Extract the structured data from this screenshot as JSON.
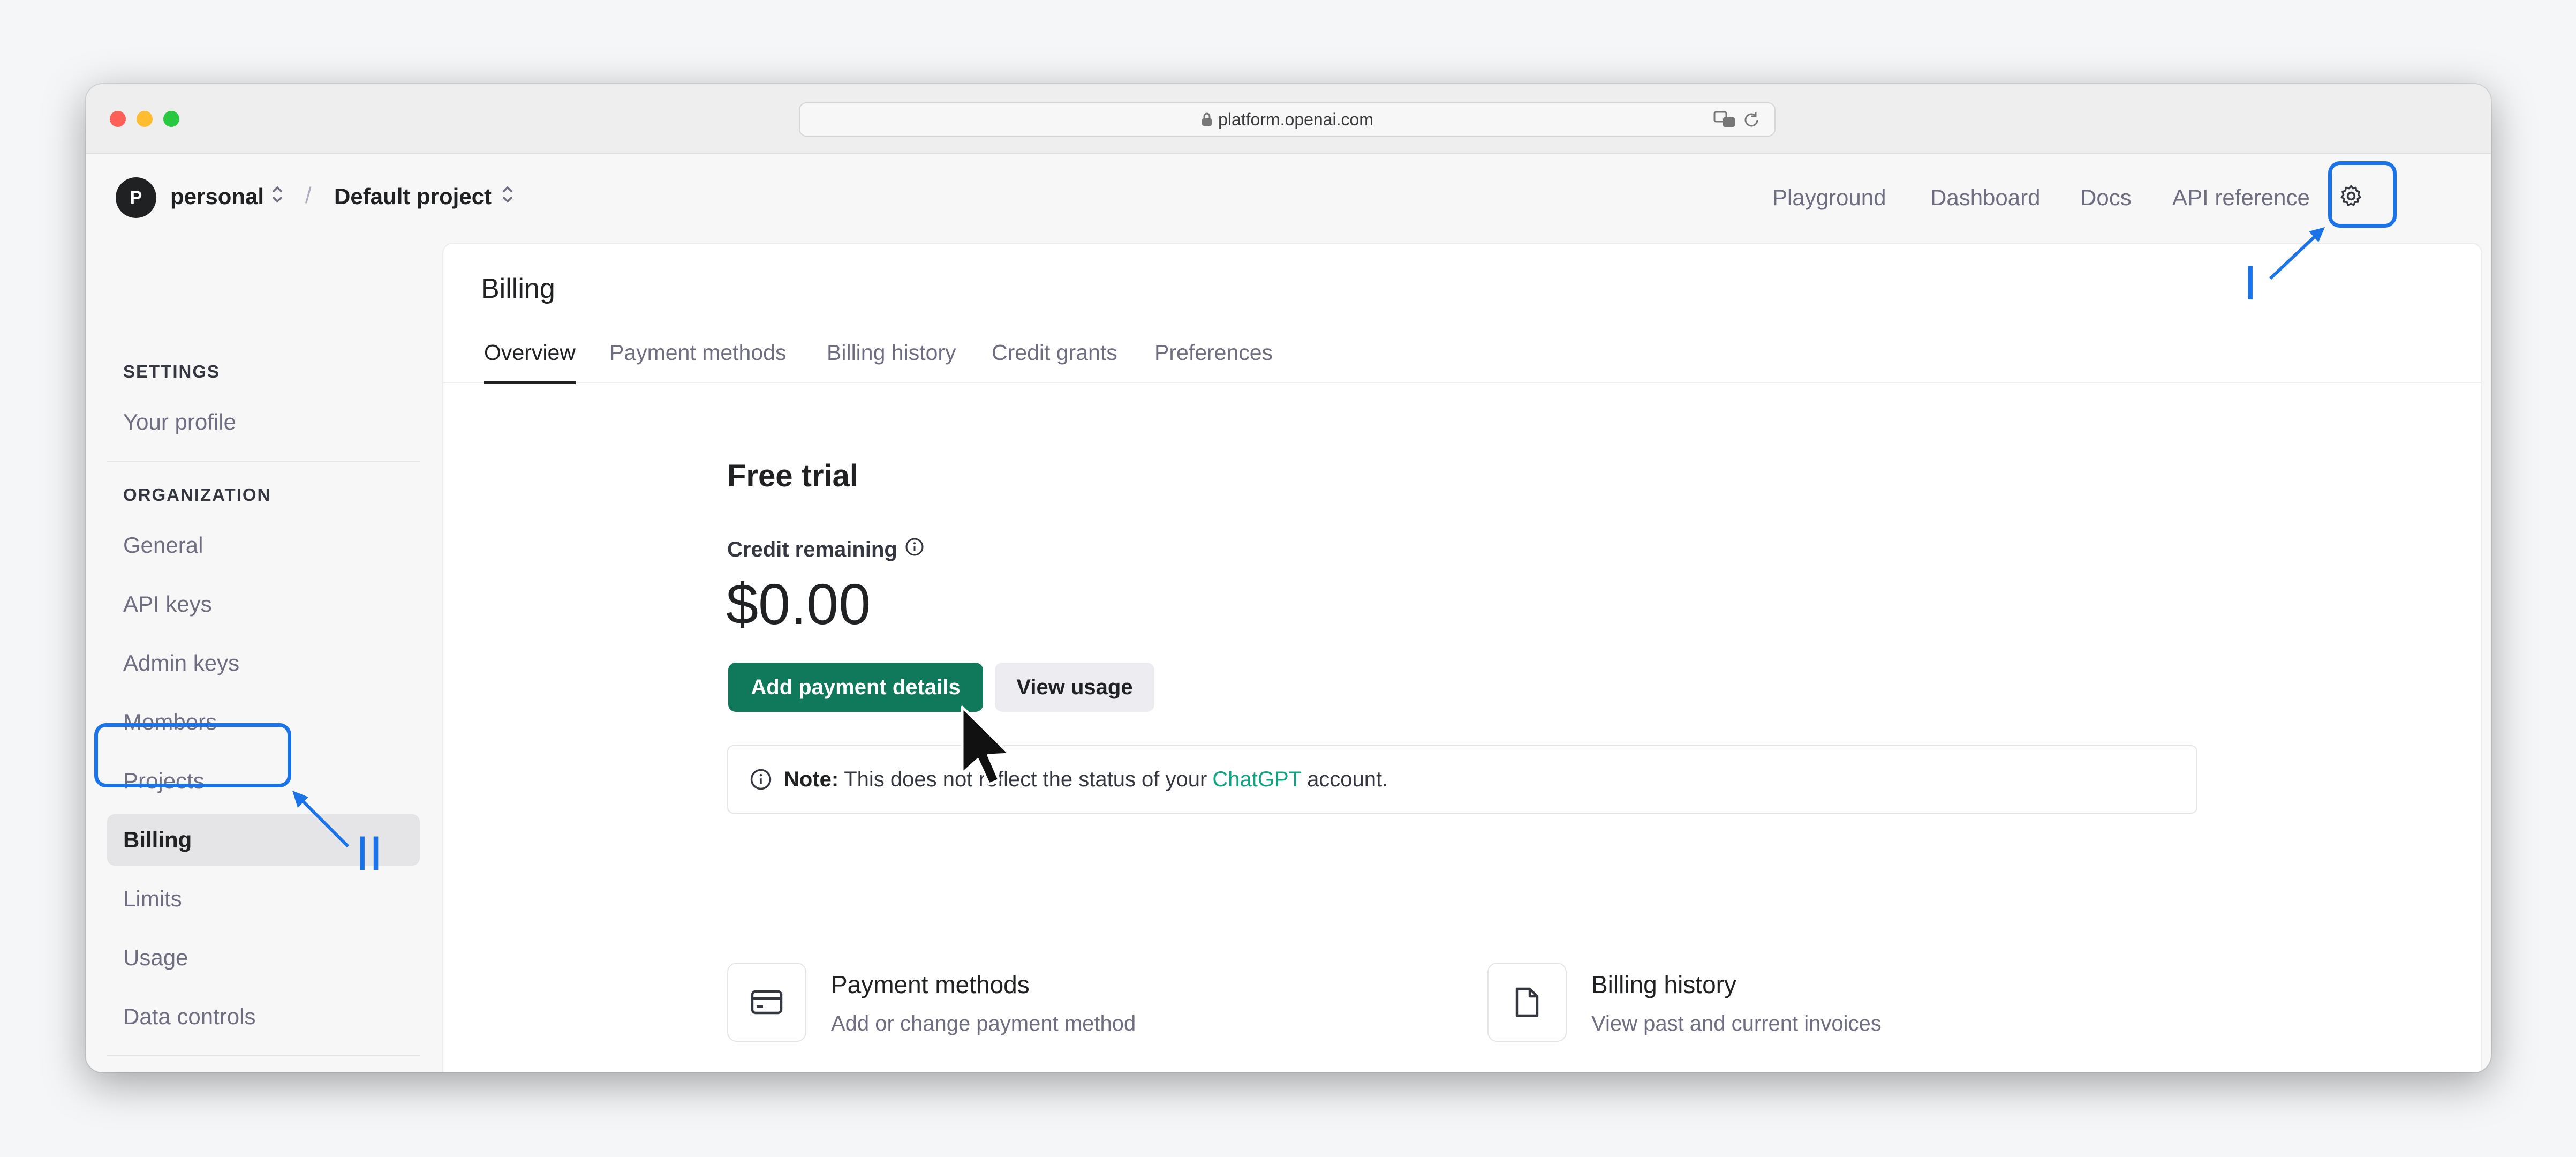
{
  "browser": {
    "url": "platform.openai.com",
    "icons": [
      "lock-icon",
      "translate-icon",
      "reload-icon"
    ]
  },
  "topbar": {
    "avatar_initial": "P",
    "org": "personal",
    "separator": "/",
    "project": "Default project",
    "nav": [
      "Playground",
      "Dashboard",
      "Docs",
      "API reference"
    ],
    "settings_icon": "gear-icon"
  },
  "sidebar": {
    "settings_heading": "SETTINGS",
    "settings_items": [
      "Your profile"
    ],
    "org_heading": "ORGANIZATION",
    "org_items": [
      "General",
      "API keys",
      "Admin keys",
      "Members",
      "Projects",
      "Billing",
      "Limits",
      "Usage",
      "Data controls"
    ],
    "active": "Billing"
  },
  "main": {
    "title": "Billing",
    "tabs": [
      "Overview",
      "Payment methods",
      "Billing history",
      "Credit grants",
      "Preferences"
    ],
    "active_tab": "Overview",
    "plan_title": "Free trial",
    "credit_label": "Credit remaining",
    "credit_amount": "$0.00",
    "add_payment_label": "Add payment details",
    "view_usage_label": "View usage",
    "note": {
      "bold": "Note:",
      "text_before": "This does not reflect the status of your",
      "link": "ChatGPT",
      "text_after": "account."
    },
    "cards": [
      {
        "title": "Payment methods",
        "desc": "Add or change payment method",
        "icon": "credit-card-icon"
      },
      {
        "title": "Billing history",
        "desc": "View past and current invoices",
        "icon": "document-icon"
      }
    ]
  },
  "annotations": {
    "step_1": "I",
    "step_2": "II",
    "color": "#1a73e8"
  },
  "colors": {
    "accent_green": "#10795b",
    "link_green": "#10a37f",
    "annotation_blue": "#1a73e8"
  }
}
